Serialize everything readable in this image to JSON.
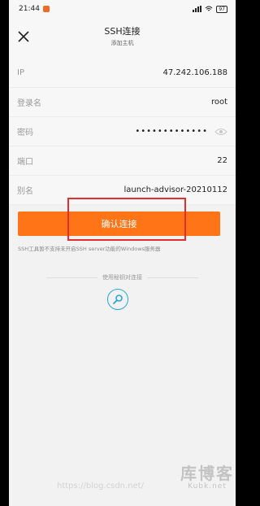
{
  "status_bar": {
    "time": "21:44",
    "battery": "97"
  },
  "header": {
    "title": "SSH连接",
    "subtitle": "添加主机"
  },
  "form": {
    "ip": {
      "label": "IP",
      "value": "47.242.106.188"
    },
    "username": {
      "label": "登录名",
      "value": "root"
    },
    "password": {
      "label": "密码",
      "masked_value": "•••••••••••••"
    },
    "port": {
      "label": "端口",
      "value": "22"
    },
    "alias": {
      "label": "别名",
      "value": "launch-advisor-20210112"
    }
  },
  "confirm_button": {
    "label": "确认连接",
    "color": "#ff7416"
  },
  "note": "SSH工具暂不支持未开启SSH server功能的Windows服务器",
  "divider_text": "使用秘钥对连接",
  "watermark": "https://blog.csdn.net/",
  "brand": {
    "name": "库博客",
    "domain": "Kubk.net"
  },
  "colors": {
    "highlight": "#e42e2e",
    "key_icon": "#2aa7d2"
  },
  "icons": [
    "close-icon",
    "eye-icon",
    "key-search-icon",
    "signal-icon",
    "wifi-icon"
  ]
}
